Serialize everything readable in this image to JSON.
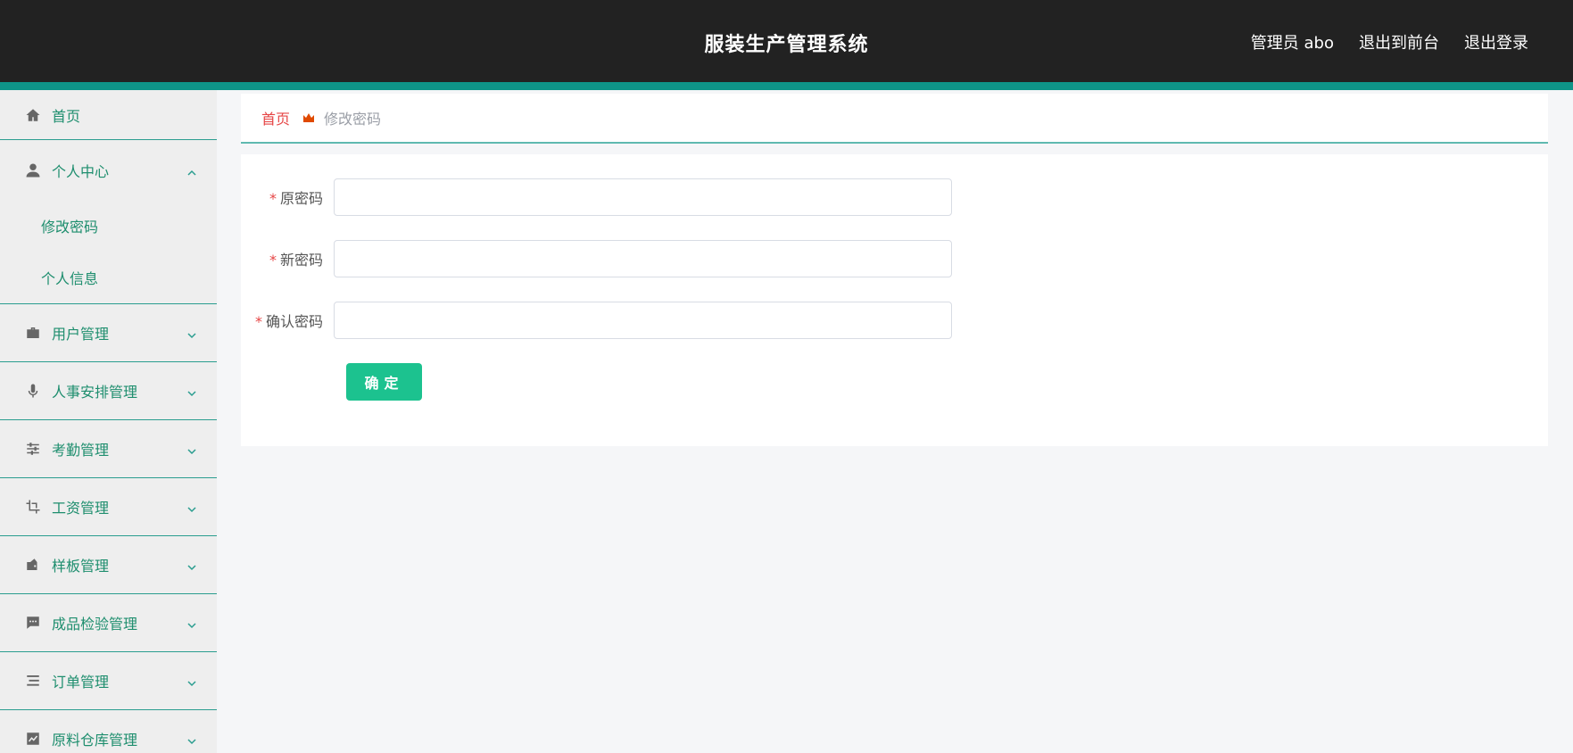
{
  "header": {
    "title": "服装生产管理系统",
    "user_label": "管理员 abo",
    "back_to_front": "退出到前台",
    "logout": "退出登录"
  },
  "sidebar": {
    "items": [
      {
        "label": "首页",
        "icon": "home-icon"
      },
      {
        "label": "个人中心",
        "icon": "user-icon",
        "open": true,
        "children": [
          "修改密码",
          "个人信息"
        ]
      },
      {
        "label": "用户管理",
        "icon": "briefcase-icon"
      },
      {
        "label": "人事安排管理",
        "icon": "microphone-icon"
      },
      {
        "label": "考勤管理",
        "icon": "sliders-icon"
      },
      {
        "label": "工资管理",
        "icon": "crop-icon"
      },
      {
        "label": "样板管理",
        "icon": "wallet-icon"
      },
      {
        "label": "成品检验管理",
        "icon": "chat-icon"
      },
      {
        "label": "订单管理",
        "icon": "list-icon"
      },
      {
        "label": "原料仓库管理",
        "icon": "chart-icon"
      }
    ]
  },
  "breadcrumb": {
    "home": "首页",
    "current": "修改密码"
  },
  "form": {
    "required_mark": "*",
    "old_password_label": "原密码",
    "new_password_label": "新密码",
    "confirm_password_label": "确认密码",
    "old_password_value": "",
    "new_password_value": "",
    "confirm_password_value": "",
    "submit_label": "确定"
  },
  "colors": {
    "header_bg": "#222222",
    "accent": "#0e9488",
    "button": "#1cc28f",
    "menu_text": "#1e8e6e",
    "breadcrumb_home": "#e64545"
  }
}
